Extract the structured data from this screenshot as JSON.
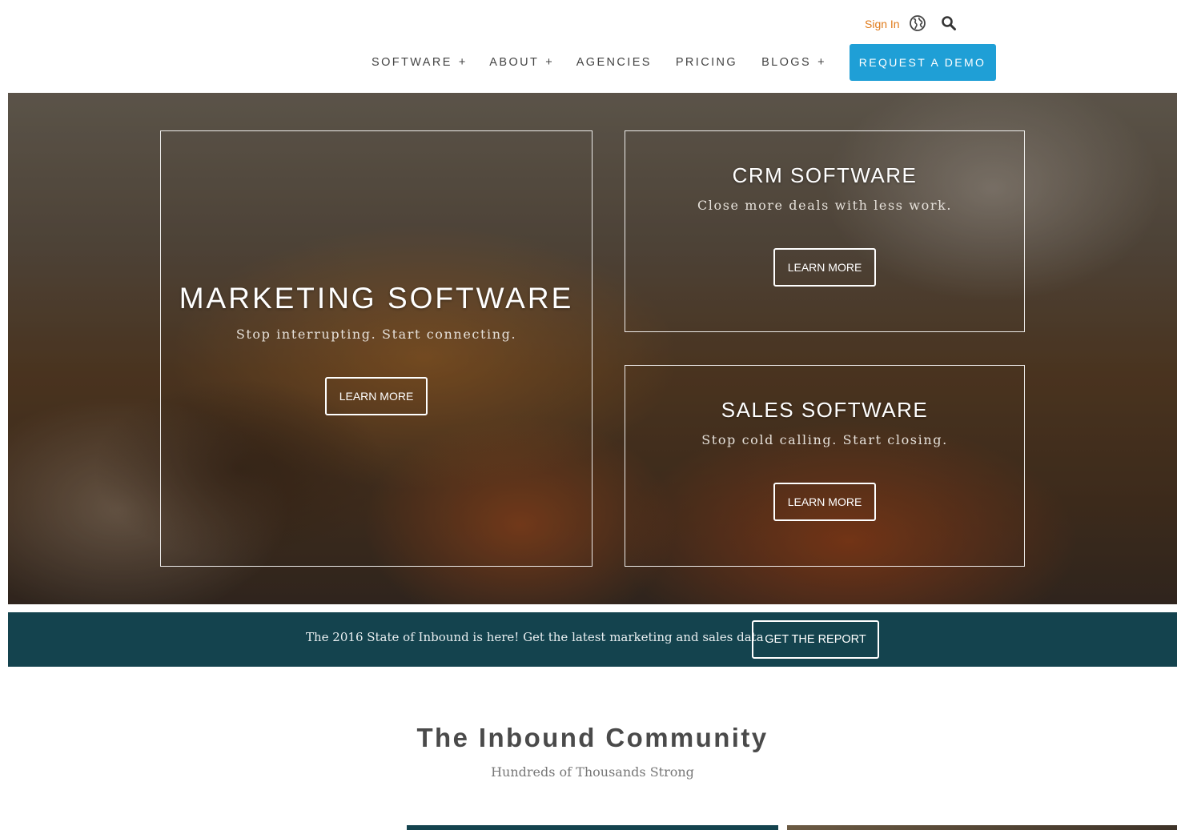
{
  "header": {
    "signin_label": "Sign In",
    "globe_icon": "globe-icon",
    "search_icon": "search-icon"
  },
  "nav": {
    "items": [
      {
        "label": "SOFTWARE",
        "has_submenu": true,
        "submenu_marker": "+"
      },
      {
        "label": "ABOUT",
        "has_submenu": true,
        "submenu_marker": "+"
      },
      {
        "label": "AGENCIES",
        "has_submenu": false
      },
      {
        "label": "PRICING",
        "has_submenu": false
      },
      {
        "label": "BLOGS",
        "has_submenu": true,
        "submenu_marker": "+"
      }
    ],
    "demo_label": "REQUEST A DEMO"
  },
  "hero": {
    "marketing": {
      "title": "MARKETING SOFTWARE",
      "tagline": "Stop interrupting. Start connecting.",
      "button": "LEARN MORE"
    },
    "crm": {
      "title": "CRM SOFTWARE",
      "tagline": "Close more deals with less work.",
      "button": "LEARN MORE"
    },
    "sales": {
      "title": "SALES SOFTWARE",
      "tagline": "Stop cold calling. Start closing.",
      "button": "LEARN MORE"
    }
  },
  "banner": {
    "text": "The 2016 State of Inbound is here! Get the latest marketing and sales data",
    "button": "GET THE REPORT"
  },
  "community": {
    "title": "The Inbound Community",
    "subtitle": "Hundreds of Thousands Strong"
  },
  "colors": {
    "accent_orange": "#e07b1a",
    "demo_blue": "#1f9fd6",
    "banner_teal": "#14434e"
  }
}
